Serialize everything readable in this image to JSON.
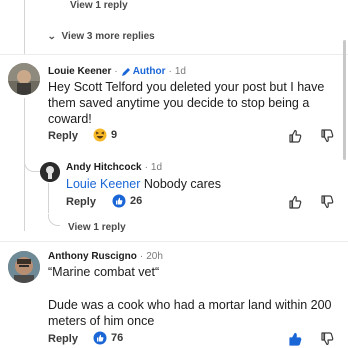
{
  "top_replies": {
    "view_reply": "View 1 reply",
    "view_more": "View 3 more replies"
  },
  "comment1": {
    "author": "Louie Keener",
    "sep": "·",
    "badge": "Author",
    "time": "1d",
    "text": "Hey Scott Telford you deleted your post but I have them saved anytime you decide to stop being a coward!",
    "reply": "Reply",
    "reaction_count": "9",
    "reaction_icon": "haha-emoji-icon"
  },
  "comment2": {
    "author": "Andy Hitchcock",
    "sep": "·",
    "time": "1d",
    "mention": "Louie Keener",
    "text": "Nobody cares",
    "reply": "Reply",
    "reaction_count": "26",
    "reaction_icon": "like-icon",
    "view_reply": "View 1 reply"
  },
  "comment3": {
    "author": "Anthony Ruscigno",
    "sep": "·",
    "time": "20h",
    "text1": "“Marine combat vet“",
    "text2": "Dude was a cook who had a mortar land within 200 meters of him once",
    "reply": "Reply",
    "reaction_count": "76",
    "reaction_icon": "like-icon"
  },
  "colors": {
    "accent": "#1a66d6",
    "text": "#1c1c1c",
    "muted": "#7a7a7a"
  }
}
